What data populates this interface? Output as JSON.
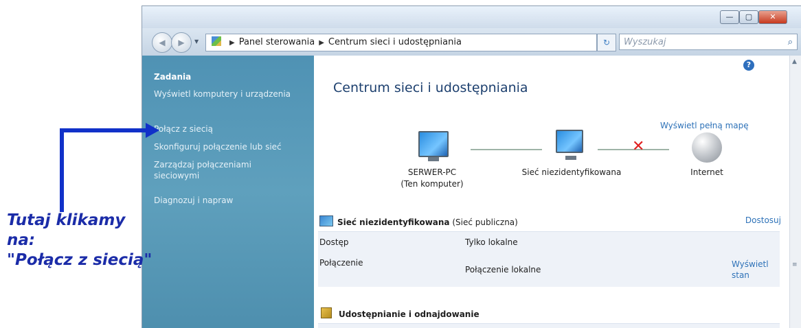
{
  "window": {
    "controls": {
      "minimize": "—",
      "maximize": "▢",
      "close": "✕"
    }
  },
  "nav": {
    "back_icon": "◀",
    "forward_icon": "▶",
    "breadcrumb": [
      "Panel sterowania",
      "Centrum sieci i udostępniania"
    ],
    "search_placeholder": "Wyszukaj"
  },
  "sidebar": {
    "heading": "Zadania",
    "items": [
      {
        "label": "Wyświetl komputery i urządzenia"
      },
      {
        "label": "Połącz z siecią"
      },
      {
        "label": "Skonfiguruj połączenie lub sieć"
      },
      {
        "label": "Zarządzaj połączeniami sieciowymi"
      },
      {
        "label": "Diagnozuj i napraw"
      }
    ]
  },
  "main": {
    "title": "Centrum sieci i udostępniania",
    "full_map_link": "Wyświetl pełną mapę",
    "map": {
      "computer": {
        "name": "SERWER-PC",
        "sub": "(Ten komputer)"
      },
      "network": {
        "name": "Sieć niezidentyfikowana"
      },
      "internet": {
        "name": "Internet"
      },
      "status_icon": "red-x-icon"
    },
    "network_section": {
      "name": "Sieć niezidentyfikowana",
      "type": "(Sieć publiczna)",
      "customize_link": "Dostosuj",
      "rows": [
        {
          "key": "Dostęp",
          "value": "Tylko lokalne"
        },
        {
          "key": "Połączenie",
          "value": "Połączenie lokalne",
          "link": "Wyświetl stan"
        }
      ]
    },
    "sharing_section": {
      "title": "Udostępnianie i odnajdowanie"
    }
  },
  "annotation": {
    "lines": [
      "Tutaj klikamy",
      "na:",
      "\"Połącz z siecią\""
    ],
    "color": "#1b2ca8"
  }
}
